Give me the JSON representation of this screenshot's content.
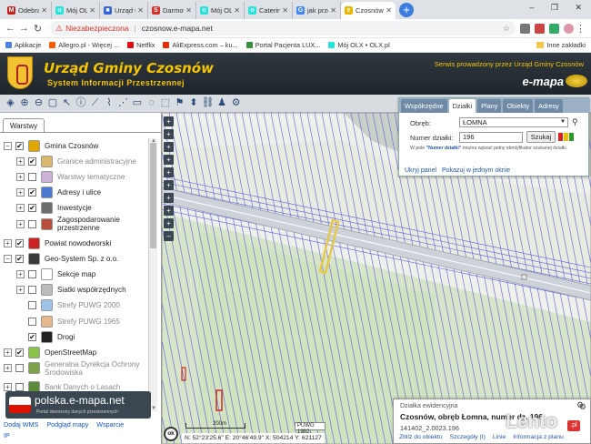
{
  "browser": {
    "tabs": [
      {
        "title": "Odebrane",
        "favicon_color": "#c5221f",
        "favicon_letter": "M"
      },
      {
        "title": "Mój OLX",
        "favicon_color": "#23e5db",
        "favicon_letter": "o"
      },
      {
        "title": "Urząd G",
        "favicon_color": "#3367d6",
        "favicon_letter": "■"
      },
      {
        "title": "Darmowe",
        "favicon_color": "#d93025",
        "favicon_letter": "S"
      },
      {
        "title": "Mój OLX",
        "favicon_color": "#23e5db",
        "favicon_letter": "o"
      },
      {
        "title": "Catering",
        "favicon_color": "#23e5db",
        "favicon_letter": "o"
      },
      {
        "title": "jak przec",
        "favicon_color": "#4285f4",
        "favicon_letter": "G"
      },
      {
        "title": "Czosnów",
        "favicon_color": "#e8b800",
        "favicon_letter": "e"
      }
    ],
    "new_tab": "+",
    "window_controls": "–  ❐  ✕",
    "address": {
      "warning": "Niezabezpieczona",
      "separator": "|",
      "url": "czosnow.e-mapa.net"
    },
    "bookmarks": [
      {
        "label": "Aplikacje",
        "color": "#4a80e8"
      },
      {
        "label": "Allegro.pl - Więcej ...",
        "color": "#ff5a00"
      },
      {
        "label": "Netflix",
        "color": "#e50914"
      },
      {
        "label": "AliExpress.com – ku...",
        "color": "#e62e04"
      },
      {
        "label": "Portal Pacjenta LUX...",
        "color": "#3a8f3a"
      },
      {
        "label": "Mój OLX • OLX.pl",
        "color": "#23e5db"
      }
    ],
    "other_bookmarks": "Inne zakładki"
  },
  "site": {
    "title": "Urząd Gminy Czosnów",
    "subtitle": "System Informacji Przestrzennej",
    "service_text": "Serwis prowadzony przez Urząd Gminy Czosnów",
    "brand": "e-mapa"
  },
  "toolbar": {
    "icons": [
      "layers-icon",
      "zoom-in-icon",
      "zoom-out-icon",
      "zoom-extent-icon",
      "pointer-icon",
      "info-icon",
      "measure-line-icon",
      "measure-area-icon",
      "measure-point-icon",
      "print-icon",
      "gps-icon",
      "select-icon",
      "bookmark-icon",
      "pan-icon",
      "link-icon",
      "user-icon",
      "settings-icon"
    ]
  },
  "layers": {
    "tab": "Warstwy",
    "items": [
      {
        "label": "Gmina Czosnów",
        "level": 0,
        "expander": "⊟",
        "checked": true,
        "icon_color": "#e0a700",
        "muted": false
      },
      {
        "label": "Granice administracyjne",
        "level": 1,
        "expander": "⊞",
        "checked": true,
        "icon_color": "#d9b86b",
        "muted": true
      },
      {
        "label": "Warstwy tematyczne",
        "level": 1,
        "expander": "⊞",
        "checked": false,
        "icon_color": "#cbb0d8",
        "muted": true
      },
      {
        "label": "Adresy i ulice",
        "level": 1,
        "expander": "⊞",
        "checked": true,
        "icon_color": "#4a7bd0",
        "muted": false
      },
      {
        "label": "Inwestycje",
        "level": 1,
        "expander": "⊞",
        "checked": true,
        "icon_color": "#6d6d6d",
        "muted": false
      },
      {
        "label": "Zagospodarowanie",
        "label2": "przestrzenne",
        "level": 1,
        "expander": "⊞",
        "checked": false,
        "icon_color": "#b84d3a",
        "muted": false
      },
      {
        "label": "Powiat nowodworski",
        "level": 0,
        "expander": "⊞",
        "checked": true,
        "icon_color": "#cc2222",
        "muted": false
      },
      {
        "label": "Geo-System Sp. z o.o.",
        "level": 0,
        "expander": "⊟",
        "checked": true,
        "icon_color": "#3a3a3a",
        "muted": false
      },
      {
        "label": "Sekcje map",
        "level": 1,
        "expander": "⊞",
        "checked": false,
        "icon_color": "#ffffff",
        "muted": false
      },
      {
        "label": "Siatki współrzędnych",
        "level": 1,
        "expander": "⊞",
        "checked": false,
        "icon_color": "#bbbbbb",
        "muted": false
      },
      {
        "label": "Strefy PUWG 2000",
        "level": 1,
        "expander": "",
        "checked": false,
        "icon_color": "#9ec5e8",
        "muted": true
      },
      {
        "label": "Strefy PUWG 1965",
        "level": 1,
        "expander": "",
        "checked": false,
        "icon_color": "#e7b98a",
        "muted": true
      },
      {
        "label": "Drogi",
        "level": 1,
        "expander": "",
        "checked": true,
        "icon_color": "#222222",
        "muted": false
      },
      {
        "label": "OpenStreetMap",
        "level": 0,
        "expander": "⊞",
        "checked": true,
        "icon_color": "#8bc34a",
        "muted": false
      },
      {
        "label": "Generalna Dyrekcja Ochrony",
        "label2": "Środowiska",
        "level": 0,
        "expander": "⊞",
        "checked": false,
        "icon_color": "#7aa34a",
        "muted": true
      },
      {
        "label": "Bank Danych o Lasach",
        "level": 0,
        "expander": "⊞",
        "checked": false,
        "icon_color": "#5a8a3a",
        "muted": true
      }
    ],
    "polska_title": "polska.e-mapa.net",
    "polska_sub": "Portal stworzony danych przestrzennych",
    "links": [
      "Dodaj WMS",
      "Podgląd mapy",
      "Wsparcie"
    ],
    "ip": "IP"
  },
  "search_panel": {
    "tabs": [
      {
        "label": "Współrzędne",
        "active": false
      },
      {
        "label": "Działki",
        "active": true
      },
      {
        "label": "Plany",
        "active": false
      },
      {
        "label": "Obiekty",
        "active": false
      },
      {
        "label": "Adresy",
        "active": false
      }
    ],
    "obreb_label": "Obręb:",
    "obreb_value": "ŁOMNA",
    "numer_label": "Numer działki:",
    "numer_value": "196",
    "search_button": "Szukaj",
    "hint_prefix": "W pole",
    "hint_bold": "\"Numer działki\"",
    "hint_rest": "można wpisać pełny identyfikator szukanej działki.",
    "links": [
      "Ukryj panel",
      "Pokazuj w jednym oknie"
    ]
  },
  "parcel_info": {
    "type": "Działka ewidencyjna",
    "description_prefix": "Czosnów, obręb Łomna, numer dz.",
    "parcel_number": "196",
    "identifier": "141402_2.0023.196",
    "links": [
      "Zbliż do obiektu",
      "Szczegóły (I)",
      "Linie",
      "Informacja z planu"
    ]
  },
  "status": {
    "ok": "ok",
    "scale": "200m",
    "coordinate_system": "PUWG 1992",
    "coords": "N: 52°23'25.6\"  E: 20°46'49.9\"  X: 504214  Y: 621127"
  },
  "watermark": "Lento",
  "watermark_tld": ".pl",
  "map_controls": [
    "+",
    "+",
    "+",
    "+",
    "+",
    "+",
    "+",
    "+",
    "+",
    "–"
  ],
  "colors": {
    "header_gold": "#f5c400",
    "parcel_line": "#5a5ae8",
    "highlight": "#e8c84a",
    "road": "#cdd2d8"
  }
}
